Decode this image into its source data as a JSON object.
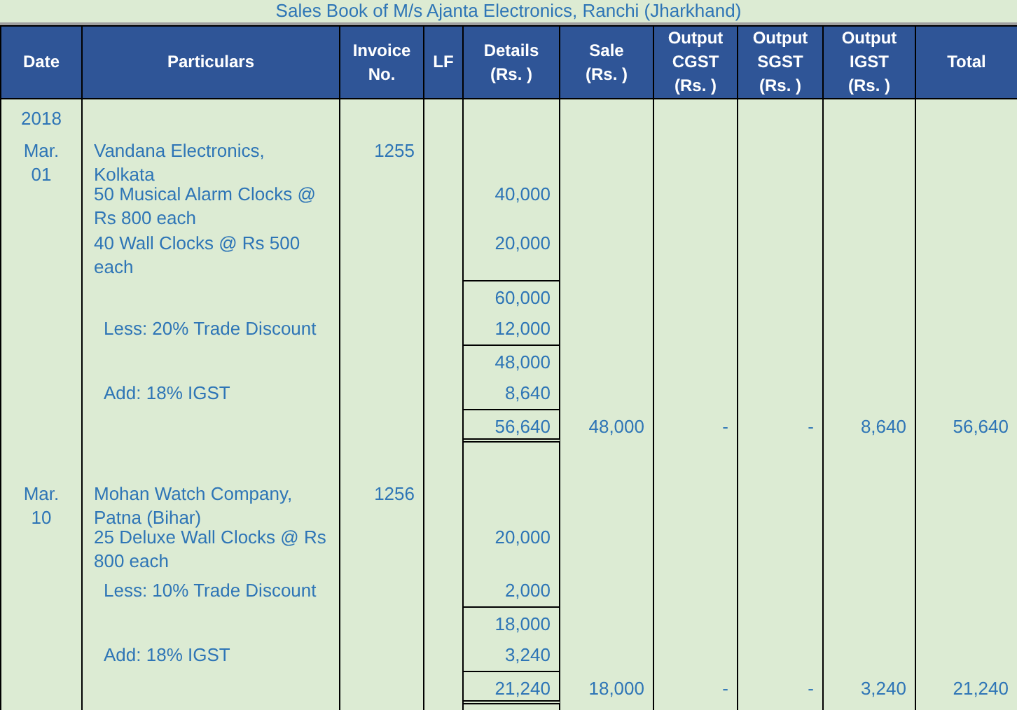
{
  "title": "Sales Book of M/s Ajanta Electronics, Ranchi (Jharkhand)",
  "columns": [
    "Date",
    "Particulars",
    "Invoice No.",
    "LF",
    "Details (Rs. )",
    "Sale (Rs. )",
    "Output CGST (Rs. )",
    "Output SGST (Rs. )",
    "Output IGST (Rs. )",
    "Total"
  ],
  "year": "2018",
  "entries": [
    {
      "date": "Mar. 01",
      "invoice": "1255",
      "lines": [
        {
          "kind": "party",
          "particular": "Vandana Electronics, Kolkata"
        },
        {
          "kind": "item",
          "particular": "50 Musical Alarm Clocks @ Rs 800 each",
          "amount": "40,000"
        },
        {
          "kind": "item",
          "particular": "40 Wall Clocks @ Rs 500 each",
          "amount": "20,000"
        },
        {
          "kind": "subtotal",
          "amount": "60,000"
        },
        {
          "kind": "adjustment",
          "particular": "Less: 20% Trade Discount",
          "amount": "12,000"
        },
        {
          "kind": "subtotal",
          "amount": "48,000"
        },
        {
          "kind": "adjustment",
          "particular": "Add: 18% IGST",
          "amount": "8,640"
        },
        {
          "kind": "total",
          "amount": "56,640",
          "sale": "48,000",
          "cgst": "-",
          "sgst": "-",
          "igst": "8,640",
          "total": "56,640"
        }
      ]
    },
    {
      "date": "Mar. 10",
      "invoice": "1256",
      "lines": [
        {
          "kind": "party",
          "particular": "Mohan Watch Company, Patna (Bihar)"
        },
        {
          "kind": "item",
          "particular": "25 Deluxe Wall Clocks @ Rs 800 each",
          "amount": "20,000"
        },
        {
          "kind": "adjustment",
          "particular": "Less: 10% Trade Discount",
          "amount": "2,000"
        },
        {
          "kind": "subtotal",
          "amount": "18,000"
        },
        {
          "kind": "adjustment",
          "particular": "Add: 18% IGST",
          "amount": "3,240"
        },
        {
          "kind": "total",
          "amount": "21,240",
          "sale": "18,000",
          "cgst": "-",
          "sgst": "-",
          "igst": "3,240",
          "total": "21,240"
        }
      ]
    }
  ]
}
